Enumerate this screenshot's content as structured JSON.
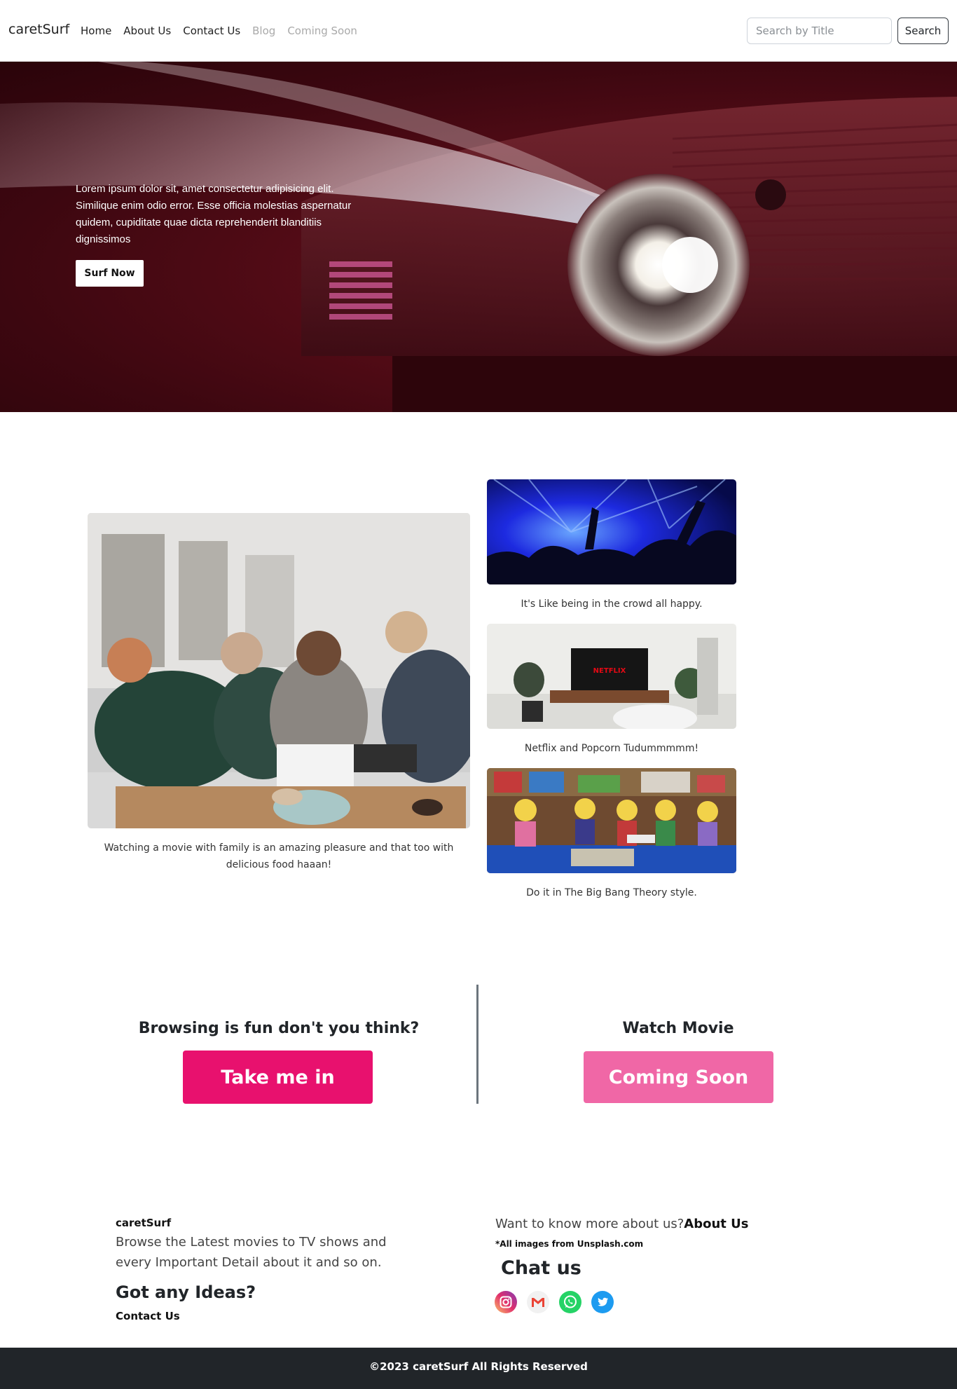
{
  "nav": {
    "brand": "caretSurf",
    "links": [
      "Home",
      "About Us",
      "Contact Us",
      "Blog",
      "Coming Soon"
    ],
    "search_placeholder": "Search by Title",
    "search_button": "Search"
  },
  "hero": {
    "text": "Lorem ipsum dolor sit, amet consectetur adipisicing elit. Similique enim odio error. Esse officia molestias aspernatur quidem, cupiditate quae dicta reprehenderit blanditiis dignissimos",
    "button": "Surf Now"
  },
  "gallery": {
    "main_caption": "Watching a movie with family is an amazing pleasure and that too with delicious food haaan!",
    "side_captions": [
      "It's Like being in the crowd all happy.",
      "Netflix and Popcorn Tudummmmm!",
      "Do it in The Big Bang Theory style."
    ],
    "tv_brand": "NETFLIX"
  },
  "cta": {
    "left_heading": "Browsing is fun don't you think?",
    "left_button": "Take me in",
    "right_heading": "Watch Movie",
    "right_button": "Coming Soon",
    "colors": {
      "primary": "#e8116e",
      "secondary": "#f067a6"
    }
  },
  "footer": {
    "brand": "caretSurf",
    "description": "Browse the Latest movies to TV shows and every Important Detail about it and so on.",
    "ideas_heading": "Got any Ideas?",
    "contact_link": "Contact Us",
    "more_text": "Want to know more about us?",
    "about_link": "About Us",
    "credit": "*All images from Unsplash.com",
    "chat_heading": "Chat us",
    "socials": [
      "instagram-icon",
      "gmail-icon",
      "whatsapp-icon",
      "twitter-icon"
    ],
    "copyright": "©2023 caretSurf All Rights Reserved"
  }
}
